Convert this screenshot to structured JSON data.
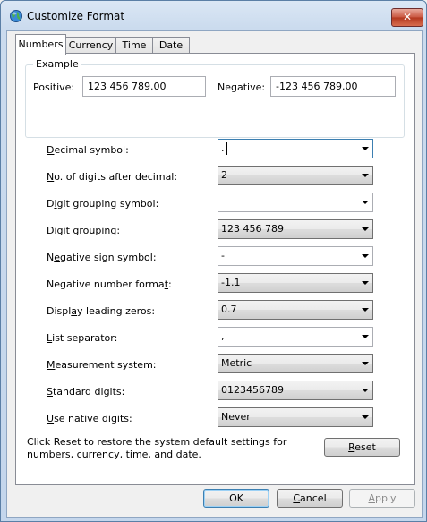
{
  "window": {
    "title": "Customize Format",
    "close_glyph": "✕"
  },
  "tabs": [
    {
      "label": "Numbers",
      "active": true
    },
    {
      "label": "Currency",
      "active": false
    },
    {
      "label": "Time",
      "active": false
    },
    {
      "label": "Date",
      "active": false
    }
  ],
  "example": {
    "caption": "Example",
    "positive_label": "Positive:",
    "positive_value": "123 456 789.00",
    "negative_label": "Negative:",
    "negative_value": "-123 456 789.00"
  },
  "settings": [
    {
      "pre": "",
      "key": "D",
      "post": "ecimal symbol:",
      "value": ".",
      "style": "editable",
      "focused": true
    },
    {
      "pre": "",
      "key": "N",
      "post": "o. of digits after decimal:",
      "value": "2",
      "style": "dropdown"
    },
    {
      "pre": "D",
      "key": "i",
      "post": "git grouping symbol:",
      "value": "",
      "style": "editable"
    },
    {
      "pre": "Digit grouping:",
      "key": "",
      "post": "",
      "value": "123 456 789",
      "style": "dropdown"
    },
    {
      "pre": "N",
      "key": "e",
      "post": "gative sign symbol:",
      "value": "-",
      "style": "editable"
    },
    {
      "pre": "Negative number forma",
      "key": "t",
      "post": ":",
      "value": "-1.1",
      "style": "dropdown"
    },
    {
      "pre": "Displ",
      "key": "a",
      "post": "y leading zeros:",
      "value": "0.7",
      "style": "dropdown"
    },
    {
      "pre": "",
      "key": "L",
      "post": "ist separator:",
      "value": ",",
      "style": "editable"
    },
    {
      "pre": "",
      "key": "M",
      "post": "easurement system:",
      "value": "Metric",
      "style": "dropdown"
    },
    {
      "pre": "",
      "key": "S",
      "post": "tandard digits:",
      "value": "0123456789",
      "style": "dropdown"
    },
    {
      "pre": "",
      "key": "U",
      "post": "se native digits:",
      "value": "Never",
      "style": "dropdown"
    }
  ],
  "info_text": "Click Reset to restore the system default settings for numbers, currency, time, and date.",
  "buttons": {
    "reset_key": "R",
    "reset_rest": "eset",
    "ok": "OK",
    "cancel_key": "C",
    "cancel_rest": "ancel",
    "apply_key": "A",
    "apply_rest": "pply"
  },
  "icons": {
    "app": "globe-with-gear-icon",
    "dropdown": "chevron-down-icon",
    "close": "close-icon"
  }
}
